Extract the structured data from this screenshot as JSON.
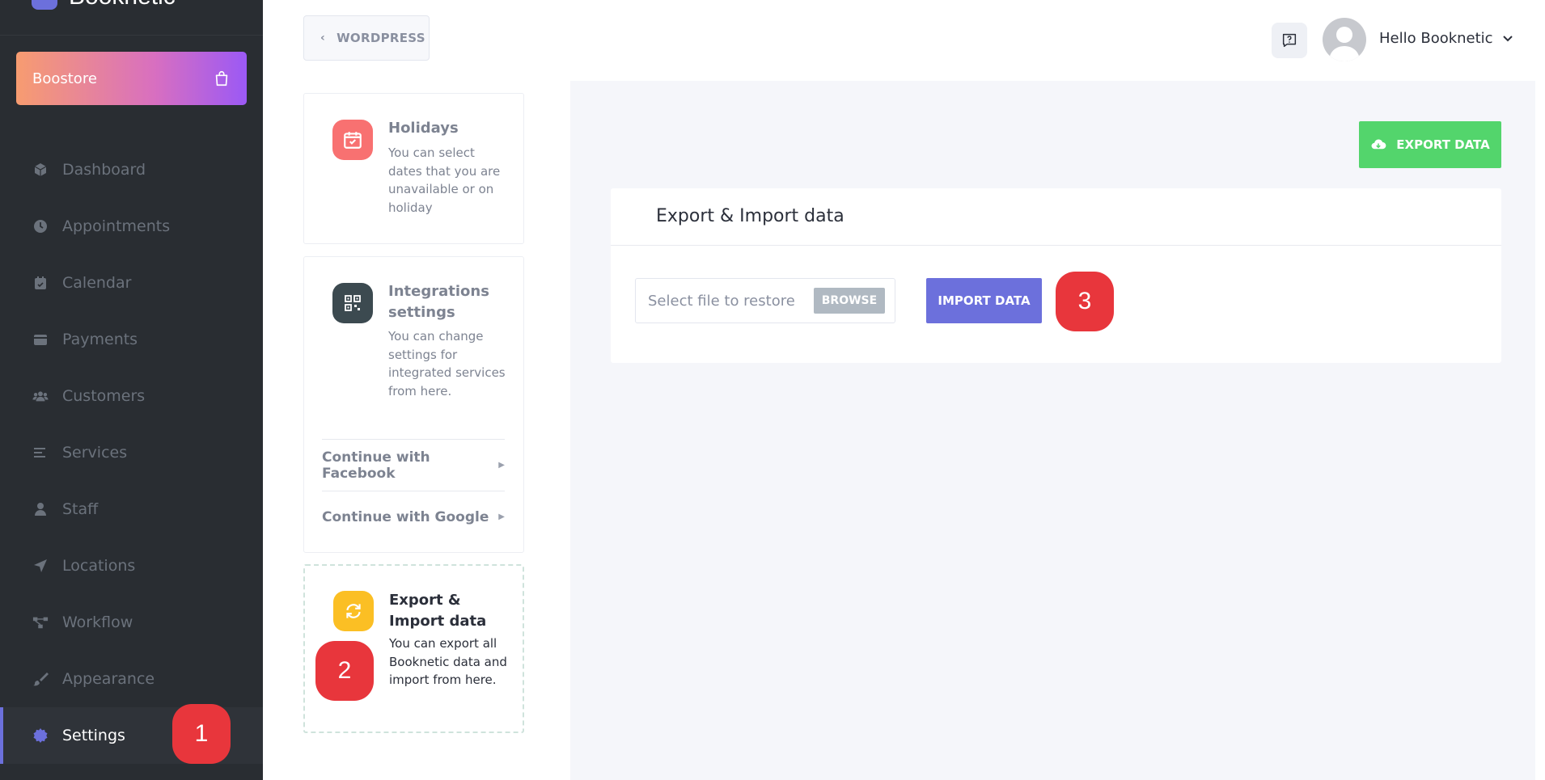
{
  "sidebar": {
    "brand": "Booknetic",
    "boostore_label": "Boostore",
    "items": [
      {
        "label": "Dashboard",
        "icon": "cube-icon"
      },
      {
        "label": "Appointments",
        "icon": "clock-icon"
      },
      {
        "label": "Calendar",
        "icon": "calendar-icon"
      },
      {
        "label": "Payments",
        "icon": "wallet-icon"
      },
      {
        "label": "Customers",
        "icon": "users-icon"
      },
      {
        "label": "Services",
        "icon": "list-icon"
      },
      {
        "label": "Staff",
        "icon": "user-icon"
      },
      {
        "label": "Locations",
        "icon": "location-arrow-icon"
      },
      {
        "label": "Workflow",
        "icon": "workflow-icon"
      },
      {
        "label": "Appearance",
        "icon": "brush-icon"
      },
      {
        "label": "Settings",
        "icon": "gear-icon",
        "active": true
      }
    ]
  },
  "markers": {
    "one": "1",
    "two": "2",
    "three": "3"
  },
  "header": {
    "back_label": "WORDPRESS",
    "greeting": "Hello Booknetic"
  },
  "settings_cards": {
    "holidays": {
      "title": "Holidays",
      "desc": "You can select dates that you are unavailable or on holiday"
    },
    "integrations": {
      "title": "Integrations settings",
      "desc": "You can change settings for integrated services from here.",
      "links": [
        "Continue with Facebook",
        "Continue with Google"
      ]
    },
    "export_import": {
      "title": "Export & Import data",
      "desc": "You can export all Booknetic data and import from here."
    }
  },
  "main": {
    "export_button": "EXPORT DATA",
    "panel_title": "Export & Import data",
    "file_placeholder": "Select file to restore",
    "browse_label": "BROWSE",
    "import_button": "IMPORT DATA"
  },
  "colors": {
    "sidebar_bg": "#292d32",
    "accent": "#6c70dc",
    "export_green": "#53d56c",
    "marker_red": "#e8363c"
  }
}
